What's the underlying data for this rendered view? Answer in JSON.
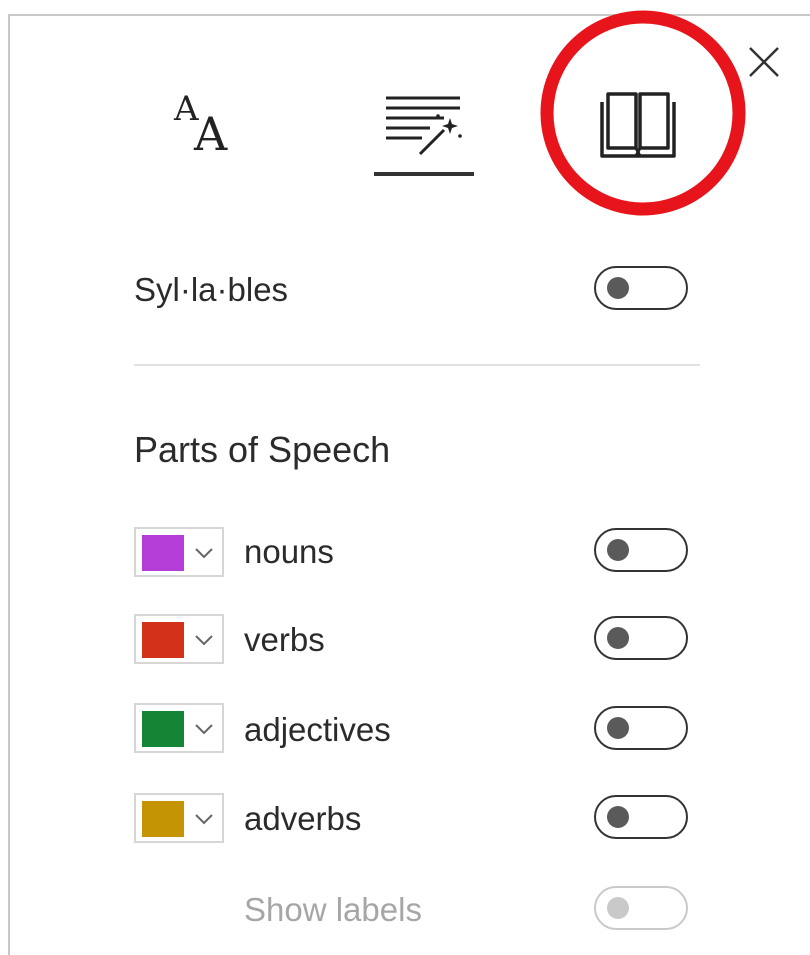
{
  "panel": {
    "close_icon": "close-icon",
    "tabs": [
      {
        "name": "text-size-tab",
        "icon": "text-size-icon",
        "selected": false
      },
      {
        "name": "text-preferences-tab",
        "icon": "text-preferences-icon",
        "selected": true
      },
      {
        "name": "grammar-tools-tab",
        "icon": "book-icon",
        "selected": false,
        "highlighted": true
      }
    ],
    "highlight_color": "#e8141b"
  },
  "syllables": {
    "label": "Syl·la·bles",
    "enabled": false
  },
  "parts_of_speech": {
    "title": "Parts of Speech",
    "items": [
      {
        "label": "nouns",
        "color": "#b33dd6",
        "enabled": false
      },
      {
        "label": "verbs",
        "color": "#d4311b",
        "enabled": false
      },
      {
        "label": "adjectives",
        "color": "#138534",
        "enabled": false
      },
      {
        "label": "adverbs",
        "color": "#c49405",
        "enabled": false
      }
    ],
    "show_labels": {
      "label": "Show labels",
      "enabled": false,
      "disabled": true
    }
  }
}
